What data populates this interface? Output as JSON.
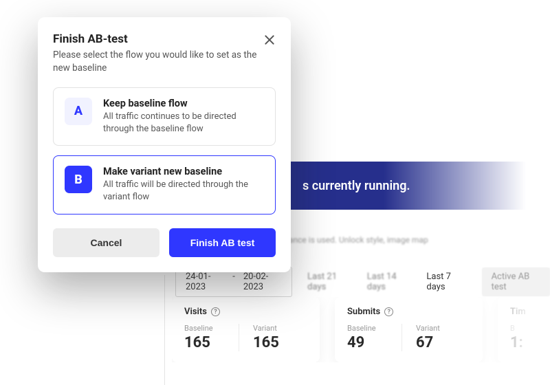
{
  "modal": {
    "title": "Finish AB-test",
    "subtitle": "Please select the flow you would like to set as the new baseline",
    "optionA": {
      "letter": "A",
      "title": "Keep baseline flow",
      "desc": "All traffic continues to be directed through the baseline flow"
    },
    "optionB": {
      "letter": "B",
      "title": "Make variant new baseline",
      "desc": "All traffic will be directed through the variant flow"
    },
    "cancel": "Cancel",
    "confirm": "Finish AB test"
  },
  "banner": {
    "text": "s currently running."
  },
  "subbanner": "ance is used. Unlock style, image map",
  "dates": {
    "from": "24-01-2023",
    "sep": "-",
    "to": "20-02-2023"
  },
  "filters": {
    "f1": "Last 21 days",
    "f2": "Last 14 days",
    "f3": "Last 7 days",
    "chip": "Active AB test"
  },
  "stats": {
    "visits": {
      "title": "Visits",
      "baselineLabel": "Baseline",
      "baselineVal": "165",
      "variantLabel": "Variant",
      "variantVal": "165"
    },
    "submits": {
      "title": "Submits",
      "baselineLabel": "Baseline",
      "baselineVal": "49",
      "variantLabel": "Variant",
      "variantVal": "67"
    },
    "time": {
      "title": "Tim",
      "baselineLabel": "B",
      "baselineVal": "1:"
    }
  },
  "help": "?"
}
